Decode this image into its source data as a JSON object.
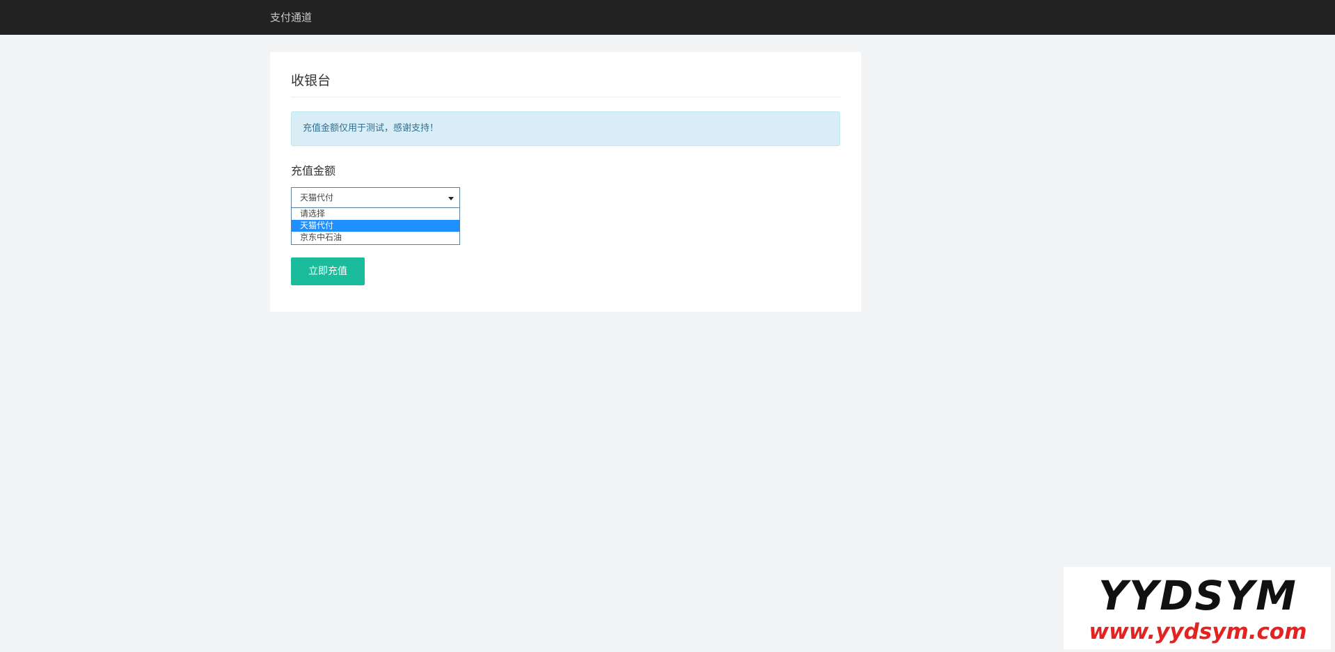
{
  "header": {
    "brand": "支付通道"
  },
  "card": {
    "title": "收银台",
    "alert": "充值金额仅用于测试，感谢支持！",
    "field_label": "充值金额",
    "select": {
      "value": "天猫代付",
      "options": [
        "请选择",
        "天猫代付",
        "京东中石油"
      ],
      "selected_index": 1
    },
    "submit_label": "立即充值"
  },
  "watermark": {
    "logo": "YYDSYM",
    "url": "www.yydsym.com"
  },
  "colors": {
    "topbar": "#222222",
    "alert_bg": "#d9edf7",
    "alert_text": "#31708f",
    "button": "#1abc9c",
    "option_highlight": "#1e90ff",
    "watermark_url": "#e32222"
  }
}
